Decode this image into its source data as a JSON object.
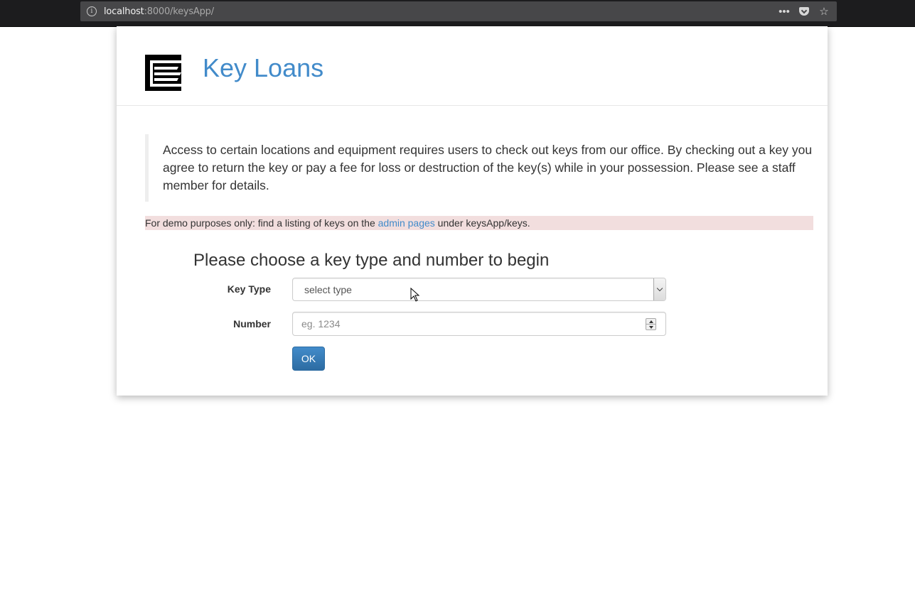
{
  "browser": {
    "url_host": "localhost",
    "url_rest": ":8000/keysApp/",
    "menu_icon": "ellipsis-icon",
    "pocket_icon": "pocket-icon",
    "bookmark_icon": "star-icon"
  },
  "header": {
    "logo": "logo-icon",
    "title": "Key Loans",
    "title_color": "#428bca"
  },
  "intro": {
    "text": "Access to certain locations and equipment requires users to check out keys from our office. By checking out a key you agree to return the key or pay a fee for loss or destruction of the key(s) while in your possession. Please see a staff member for details."
  },
  "demo_note": {
    "before": "For demo purposes only: find a listing of keys on the ",
    "link": "admin pages",
    "after": " under keysApp/keys.",
    "background": "#f2dede"
  },
  "form": {
    "heading": "Please choose a key type and number to begin",
    "key_type_label": "Key Type",
    "key_type_value": "select type",
    "number_label": "Number",
    "number_placeholder": "eg. 1234",
    "number_value": "",
    "submit_label": "OK",
    "button_color": "#428bca"
  }
}
